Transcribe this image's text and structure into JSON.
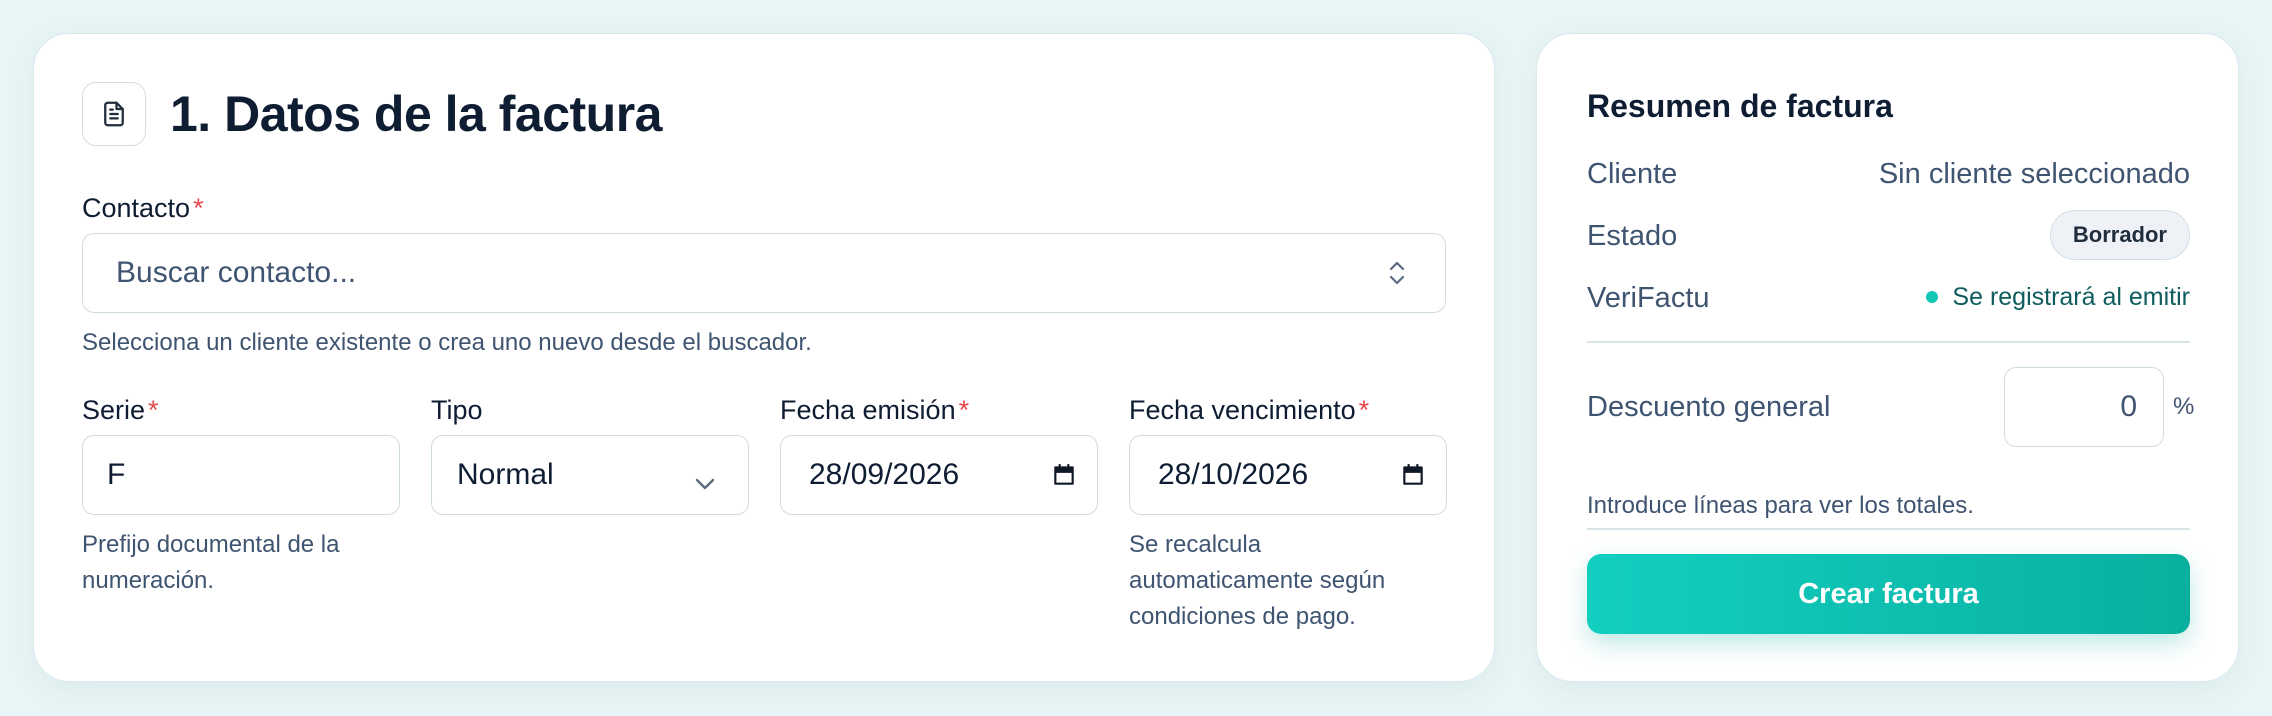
{
  "invoice_form": {
    "section_title": "1. Datos de la factura",
    "contact": {
      "label": "Contacto",
      "required_mark": "*",
      "placeholder": "Buscar contacto...",
      "helper": "Selecciona un cliente existente o crea uno nuevo desde el buscador."
    },
    "serie": {
      "label": "Serie",
      "required_mark": "*",
      "value": "F",
      "helper_line1": "Prefijo documental de la",
      "helper_line2": "numeración."
    },
    "tipo": {
      "label": "Tipo",
      "value": "Normal"
    },
    "fecha_emision": {
      "label": "Fecha emisión",
      "required_mark": "*",
      "value": "28/09/2026"
    },
    "fecha_vencimiento": {
      "label": "Fecha vencimiento",
      "required_mark": "*",
      "value": "28/10/2026",
      "helper_line1": "Se recalcula",
      "helper_line2": "automaticamente según",
      "helper_line3": "condiciones de pago."
    }
  },
  "summary": {
    "title": "Resumen de factura",
    "cliente_label": "Cliente",
    "cliente_value": "Sin cliente seleccionado",
    "estado_label": "Estado",
    "estado_badge": "Borrador",
    "verifactu_label": "VeriFactu",
    "verifactu_value": "Se registrará al emitir",
    "verifactu_dot_color": "#14c7b6",
    "descuento_label": "Descuento general",
    "descuento_value": "0",
    "descuento_unit": "%",
    "note": "Introduce líneas para ver los totales.",
    "cta": "Crear factura",
    "cta_color": "#0cc0b0"
  }
}
